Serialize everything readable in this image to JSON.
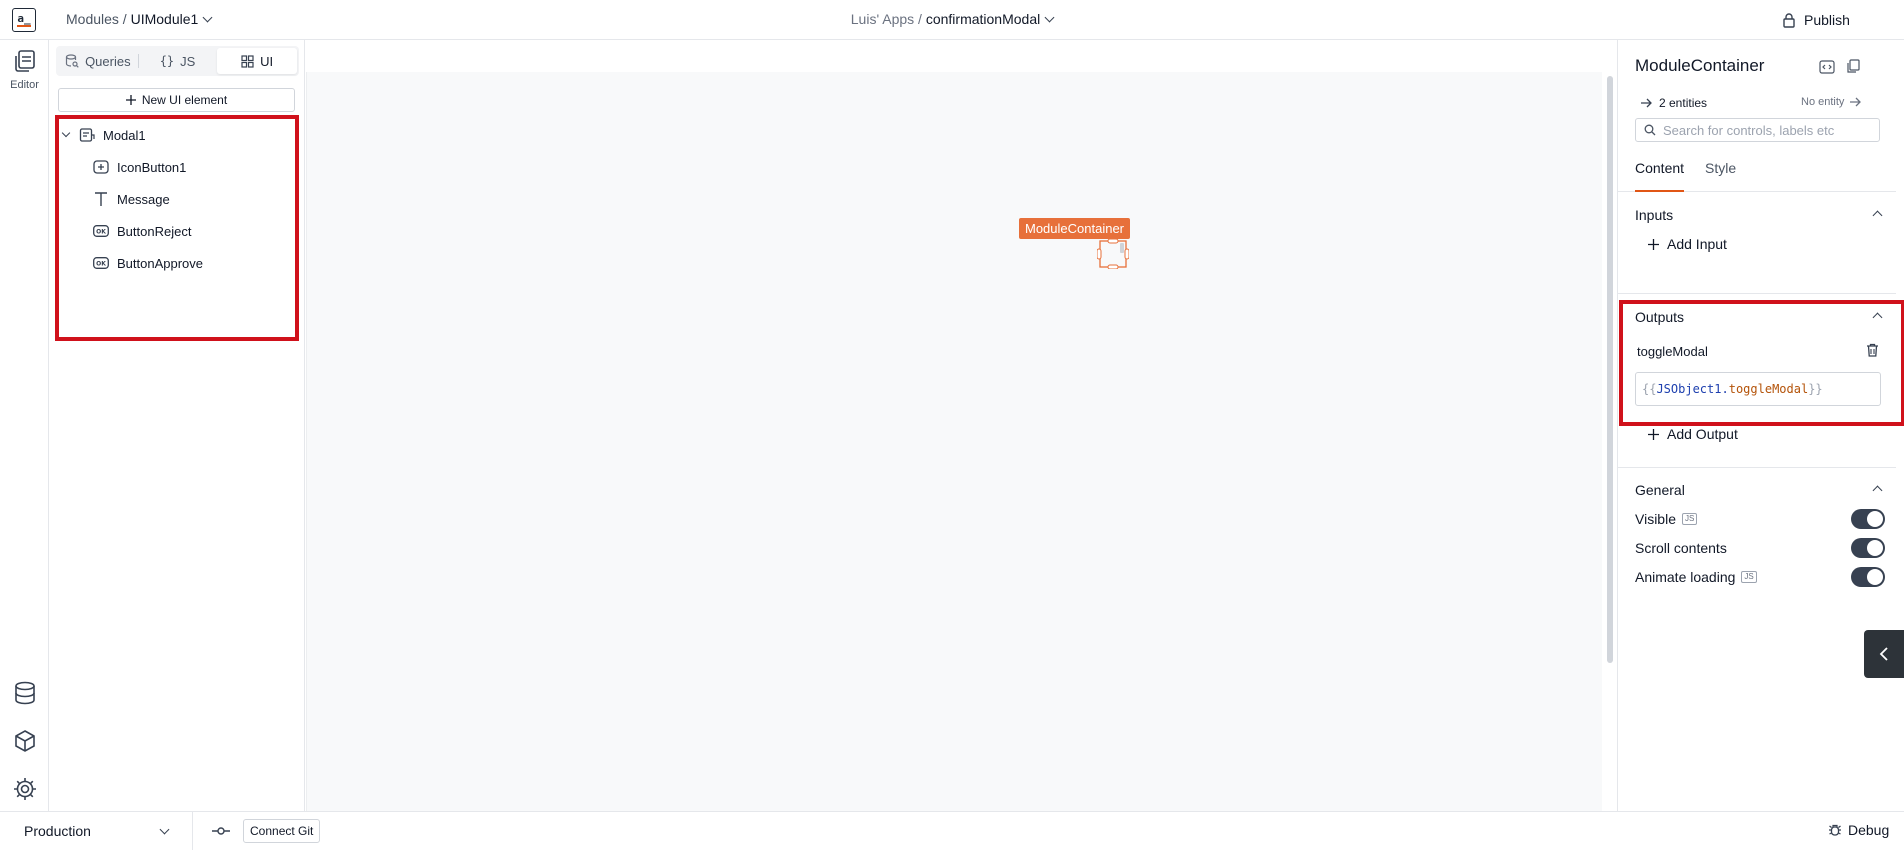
{
  "header": {
    "logo_text": "a_",
    "breadcrumb_prefix": "Modules / ",
    "breadcrumb_current": "UIModule1",
    "app_prefix": "Luis' Apps / ",
    "app_current": "confirmationModal",
    "publish_label": "Publish"
  },
  "rail": {
    "editor_label": "Editor"
  },
  "explorer": {
    "tabs": [
      {
        "label": "Queries",
        "icon": "queries-icon"
      },
      {
        "label": "JS",
        "icon": "braces-icon"
      },
      {
        "label": "UI",
        "icon": "widgets-icon"
      }
    ],
    "active_tab": "UI",
    "new_ui_label": "New UI element",
    "tree": {
      "root": {
        "label": "Modal1",
        "icon": "modal-icon",
        "expanded": true
      },
      "children": [
        {
          "label": "IconButton1",
          "icon": "icon-button-icon"
        },
        {
          "label": "Message",
          "icon": "text-icon"
        },
        {
          "label": "ButtonReject",
          "icon": "button-icon"
        },
        {
          "label": "ButtonApprove",
          "icon": "button-icon"
        }
      ]
    }
  },
  "canvas": {
    "selected_label": "ModuleContainer"
  },
  "properties": {
    "title": "ModuleContainer",
    "entities_left": "2 entities",
    "entities_right": "No entity",
    "search_placeholder": "Search for controls, labels etc",
    "tabs": [
      "Content",
      "Style"
    ],
    "active_tab": "Content",
    "inputs": {
      "heading": "Inputs",
      "add_label": "Add Input"
    },
    "outputs": {
      "heading": "Outputs",
      "items": [
        {
          "name": "toggleModal",
          "value_open": "{{",
          "value_object": "JSObject1",
          "value_dot": ".",
          "value_key": "toggleModal",
          "value_close": "}}"
        }
      ],
      "add_label": "Add Output"
    },
    "general": {
      "heading": "General",
      "rows": [
        {
          "label": "Visible",
          "js_badge": "JS",
          "enabled": true
        },
        {
          "label": "Scroll contents",
          "js_badge": "",
          "enabled": true
        },
        {
          "label": "Animate loading",
          "js_badge": "JS",
          "enabled": true
        }
      ]
    }
  },
  "footer": {
    "environment": "Production",
    "connect_git_label": "Connect Git",
    "debug_label": "Debug"
  },
  "colors": {
    "accent": "#e15615",
    "module_label_bg": "#e7703a",
    "highlight_red": "#d0111b",
    "toggle_on": "#374151"
  }
}
